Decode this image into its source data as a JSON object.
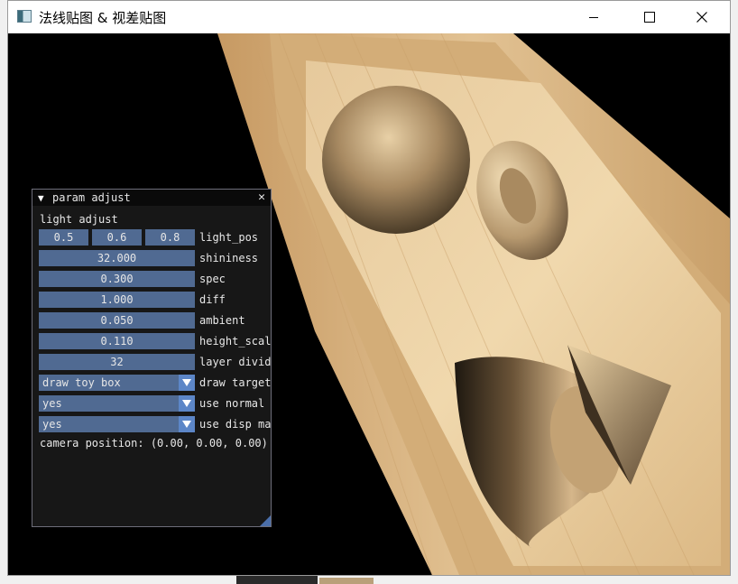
{
  "window": {
    "title": "法线贴图 & 视差贴图",
    "controls": {
      "minimize": "minimize-icon",
      "maximize": "maximize-icon",
      "close": "close-icon"
    }
  },
  "panel": {
    "title": "param adjust",
    "section_label": "light adjust",
    "light_pos": {
      "values": [
        "0.5",
        "0.6",
        "0.8"
      ],
      "label": "light_pos"
    },
    "sliders": [
      {
        "value": "32.000",
        "label": "shininess"
      },
      {
        "value": "0.300",
        "label": "spec"
      },
      {
        "value": "1.000",
        "label": "diff"
      },
      {
        "value": "0.050",
        "label": "ambient"
      },
      {
        "value": "0.110",
        "label": "height_scal"
      },
      {
        "value": "32",
        "label": "layer divid"
      }
    ],
    "combos": [
      {
        "value": "draw toy box",
        "label": "draw target"
      },
      {
        "value": "yes",
        "label": "use normal ı"
      },
      {
        "value": "yes",
        "label": "use disp ma"
      }
    ],
    "camera_text": "camera position: (0.00, 0.00, 0.00)"
  },
  "colors": {
    "frame_bg": "#506a92",
    "combo_arrow": "#5c86c7",
    "panel_bg": "#181818",
    "wood": "#d9b98a"
  }
}
